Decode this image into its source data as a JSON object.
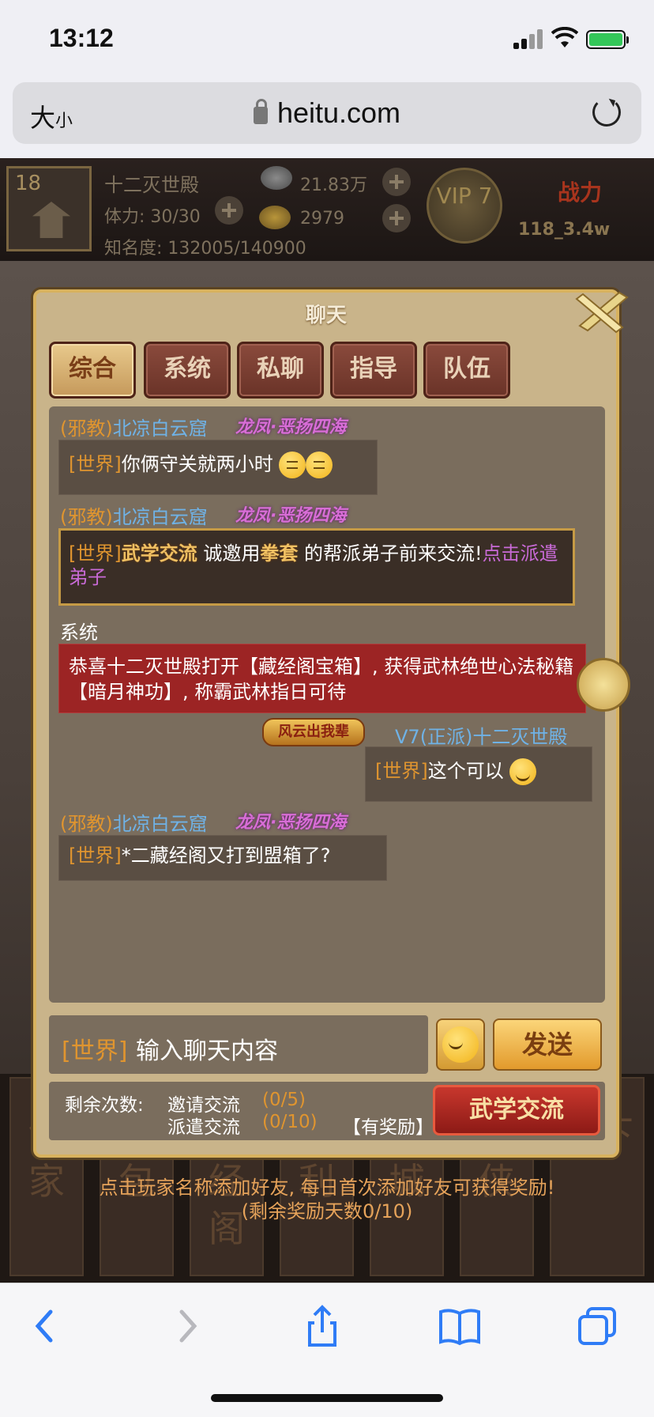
{
  "status": {
    "time": "13:12"
  },
  "browser": {
    "text_size_label": "大",
    "text_size_small": "小",
    "url": "heitu.com"
  },
  "game_header": {
    "level": "18",
    "player_name": "十二灭世殿",
    "stamina": "体力: 30/30",
    "fame": "知名度: 132005/140900",
    "silver": "21.83万",
    "gold": "2979",
    "vip": "VIP 7",
    "power_label": "战力",
    "power_value": "118_3.4w"
  },
  "chat_dialog": {
    "title": "聊天",
    "tabs": [
      "综合",
      "系统",
      "私聊",
      "指导",
      "队伍"
    ],
    "active_tab": 0,
    "messages": [
      {
        "faction": "(邪教)",
        "name": "北凉白云窟",
        "title_badge": "龙凤·恶扬四海",
        "channel": "[世界]",
        "text": "你俩守关就两小时"
      },
      {
        "faction": "(邪教)",
        "name": "北凉白云窟",
        "title_badge": "龙凤·恶扬四海",
        "channel": "[世界]",
        "tag": "武学交流",
        "text_a": "诚邀用",
        "tag2": "拳套",
        "text_b": "的帮派弟子前来交流!",
        "link": "点击派遣弟子"
      },
      {
        "sender": "系统",
        "text": "恭喜十二灭世殿打开【藏经阁宝箱】, 获得武林绝世心法秘籍【暗月神功】, 称霸武林指日可待"
      },
      {
        "badge": "风云出我辈",
        "vip_faction": "V7(正派)",
        "name": "十二灭世殿",
        "channel": "[世界]",
        "text": "这个可以"
      },
      {
        "faction": "(邪教)",
        "name": "北凉白云窟",
        "title_badge": "龙凤·恶扬四海",
        "channel": "[世界]",
        "text": "*二藏经阁又打到盟箱了?"
      }
    ],
    "input": {
      "channel": "[世界]",
      "placeholder": "输入聊天内容"
    },
    "send_label": "发送",
    "quota": {
      "label": "剩余次数:",
      "invite_label": "邀请交流",
      "invite_count": "(0/5)",
      "dispatch_label": "派遣交流",
      "dispatch_count": "(0/10)",
      "reward": "【有奖励】",
      "button": "武学交流"
    }
  },
  "notice": {
    "line1": "点击玩家名称添加好友, 每日首次添加好友可获得奖励!",
    "line2": "(剩余奖励天数0/10)"
  },
  "bottom_tiles": [
    "剑家",
    "背包",
    "藏经阁",
    "福利",
    "商城",
    "侍侠",
    "天下"
  ],
  "colors": {
    "faction": "#e0952f",
    "username": "#6fb2e6",
    "system_bg": "#9c2424",
    "link": "#c86ad6"
  }
}
